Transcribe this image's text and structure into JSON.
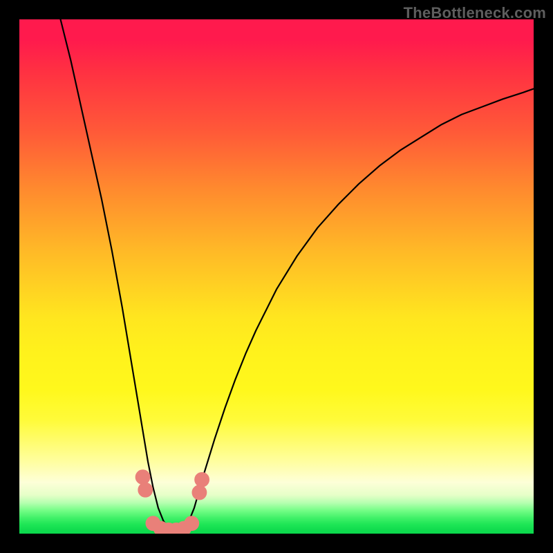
{
  "watermark": {
    "text": "TheBottleneck.com"
  },
  "colors": {
    "curve_stroke": "#000000",
    "marker_fill": "#e98079",
    "marker_stroke": "#e98079"
  },
  "chart_data": {
    "type": "line",
    "title": "",
    "xlabel": "",
    "ylabel": "",
    "xlim": [
      0,
      100
    ],
    "ylim": [
      0,
      100
    ],
    "grid": false,
    "legend": false,
    "curve_x": [
      8,
      10,
      12,
      14,
      16,
      18,
      20,
      22,
      23,
      24,
      25,
      26,
      27,
      28,
      29,
      30,
      31,
      32,
      33,
      34,
      35,
      36,
      38,
      40,
      42,
      44,
      46,
      48,
      50,
      54,
      58,
      62,
      66,
      70,
      74,
      78,
      82,
      86,
      90,
      94,
      98,
      100
    ],
    "curve_y": [
      100,
      92,
      83,
      74,
      65,
      55,
      44,
      32,
      26,
      20,
      14,
      9,
      5,
      2.5,
      1,
      0.5,
      0.5,
      1,
      2.5,
      5,
      8.5,
      12,
      18.5,
      24.5,
      30,
      35,
      39.5,
      43.5,
      47.5,
      54,
      59.5,
      64,
      68,
      71.5,
      74.5,
      77,
      79.5,
      81.5,
      83,
      84.5,
      85.8,
      86.5
    ],
    "markers": [
      {
        "x": 24.0,
        "y": 11.0
      },
      {
        "x": 24.5,
        "y": 8.5
      },
      {
        "x": 26.0,
        "y": 2.0
      },
      {
        "x": 27.5,
        "y": 1.0
      },
      {
        "x": 29.0,
        "y": 0.7
      },
      {
        "x": 30.5,
        "y": 0.7
      },
      {
        "x": 32.0,
        "y": 1.0
      },
      {
        "x": 33.5,
        "y": 2.0
      },
      {
        "x": 35.0,
        "y": 8.0
      },
      {
        "x": 35.5,
        "y": 10.5
      }
    ],
    "marker_radius_pct": 1.4
  }
}
